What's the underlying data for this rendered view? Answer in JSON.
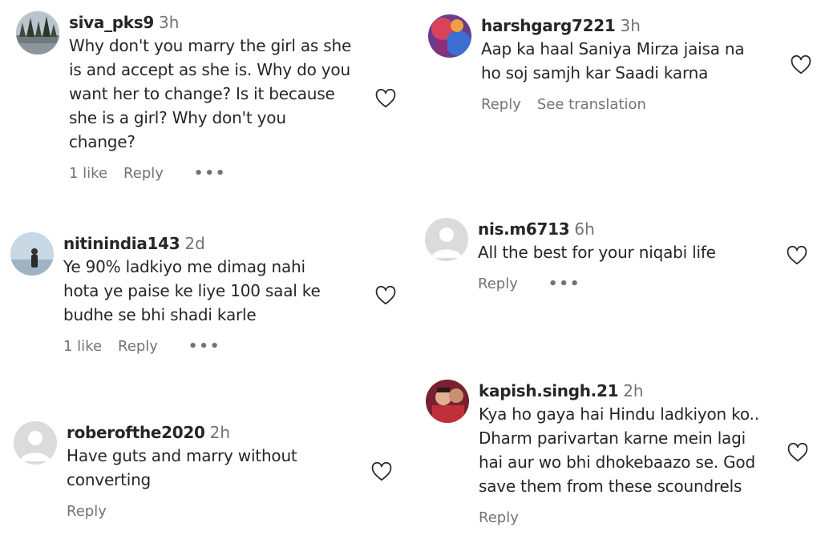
{
  "comments": [
    {
      "username": "siva_pks9",
      "time": "3h",
      "lines": [
        "Why don't you marry the girl as she",
        "is and accept as she is. Why do you",
        "want her to change? Is it because",
        "she is a girl? Why don't you",
        "change?"
      ],
      "likes": "1 like",
      "reply": "Reply",
      "more": "•••",
      "avatar": "lake-trees-photo"
    },
    {
      "username": "nitinindia143",
      "time": "2d",
      "lines": [
        "Ye 90% ladkiyo me dimag nahi",
        "hota ye paise ke liye 100 saal ke",
        "budhe se bhi shadi karle"
      ],
      "likes": "1 like",
      "reply": "Reply",
      "more": "•••",
      "avatar": "person-by-sea-photo"
    },
    {
      "username": "roberofthe2020",
      "time": "2h",
      "lines": [
        "Have guts and marry without",
        "converting"
      ],
      "reply": "Reply",
      "avatar": "default-avatar"
    },
    {
      "username": "harshgarg7221",
      "time": "3h",
      "lines": [
        "Aap ka haal Saniya Mirza jaisa na",
        "ho soj samjh kar Saadi karna"
      ],
      "reply": "Reply",
      "translate": "See translation",
      "avatar": "colorful-photo"
    },
    {
      "username": "nis.m6713",
      "time": "6h",
      "lines": [
        "All the best for your niqabi life"
      ],
      "reply": "Reply",
      "more": "•••",
      "avatar": "default-avatar"
    },
    {
      "username": "kapish.singh.21",
      "time": "2h",
      "lines": [
        "Kya ho gaya hai Hindu ladkiyon ko..",
        "Dharm parivartan karne mein lagi",
        "hai aur wo bhi dhokebaazo se. God",
        "save them from these scoundrels"
      ],
      "reply": "Reply",
      "avatar": "selfie-photo"
    }
  ],
  "colors": {
    "text": "#262626",
    "secondary": "#737373",
    "avatar_placeholder": "#dbdbdb"
  }
}
